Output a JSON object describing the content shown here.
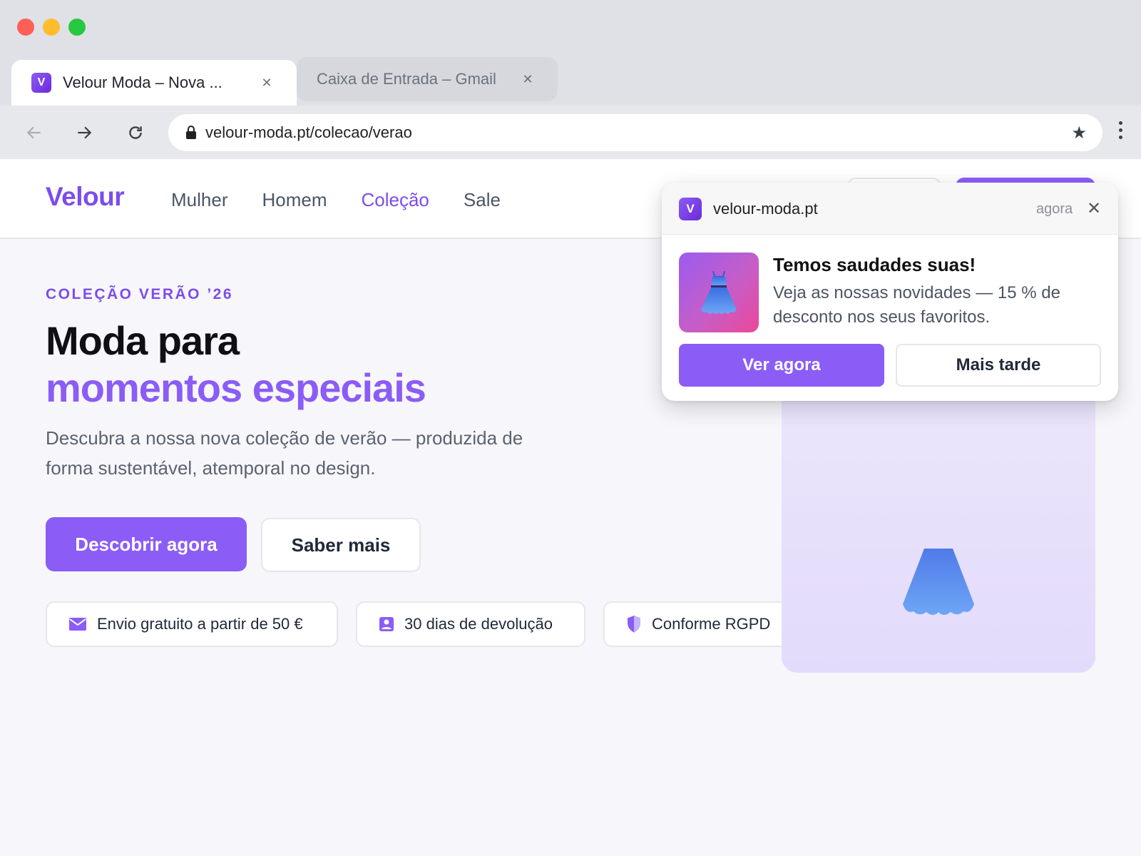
{
  "browser": {
    "tabs": [
      {
        "title": "Velour Moda – Nova ...",
        "favicon": "V",
        "active": true
      },
      {
        "title": "Caixa de Entrada – Gmail",
        "active": false
      }
    ],
    "url": "velour-moda.pt/colecao/verao"
  },
  "site": {
    "logo": "Velour",
    "nav": [
      "Mulher",
      "Homem",
      "Coleção",
      "Sale"
    ],
    "active_nav": "Coleção",
    "accent_color": "#8b5cf6"
  },
  "hero": {
    "eyebrow": "COLEÇÃO VERÃO ’26",
    "title_line1": "Moda para",
    "title_line2": "momentos especiais",
    "description": "Descubra a nossa nova coleção de verão — produzida de forma sustentável, atemporal no design.",
    "primary_button": "Descobrir agora",
    "secondary_button": "Saber mais"
  },
  "features": [
    {
      "icon": "mail-icon",
      "text": "Envio gratuito a partir de 50 €"
    },
    {
      "icon": "contact-card-icon",
      "text": "30 dias de devolução"
    },
    {
      "icon": "shield-icon",
      "text": "Conforme RGPD"
    }
  ],
  "notification": {
    "site": "velour-moda.pt",
    "favicon": "V",
    "time": "agora",
    "title": "Temos saudades suas!",
    "body": "Veja as nossas novidades — 15 % de desconto nos seus favoritos.",
    "primary_button": "Ver agora",
    "secondary_button": "Mais tarde"
  }
}
